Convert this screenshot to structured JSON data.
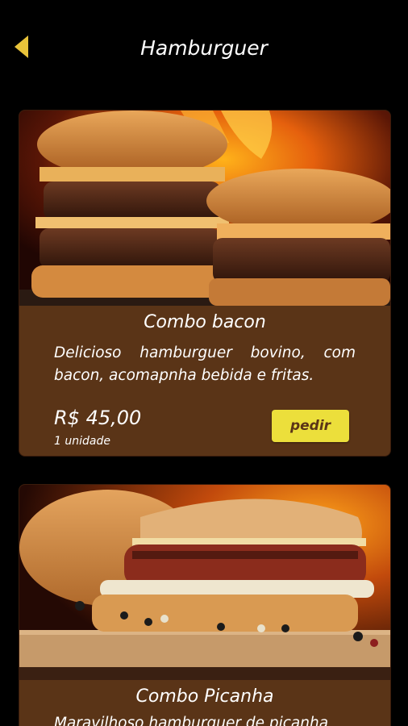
{
  "header": {
    "title": "Hamburguer",
    "back_icon": "back-arrow-icon"
  },
  "colors": {
    "background": "#000000",
    "card": "#5a3417",
    "button": "#ecdf3b",
    "accent_icon": "#e8c33a"
  },
  "products": [
    {
      "name": "Combo bacon",
      "description": "Delicioso hamburguer bovino, com bacon, acomapnha bebida e fritas.",
      "price": "R$ 45,00",
      "unit": "1 unidade",
      "order_label": "pedir"
    },
    {
      "name": "Combo Picanha",
      "description": "Maravilhoso hamburguer de picanha"
    }
  ]
}
